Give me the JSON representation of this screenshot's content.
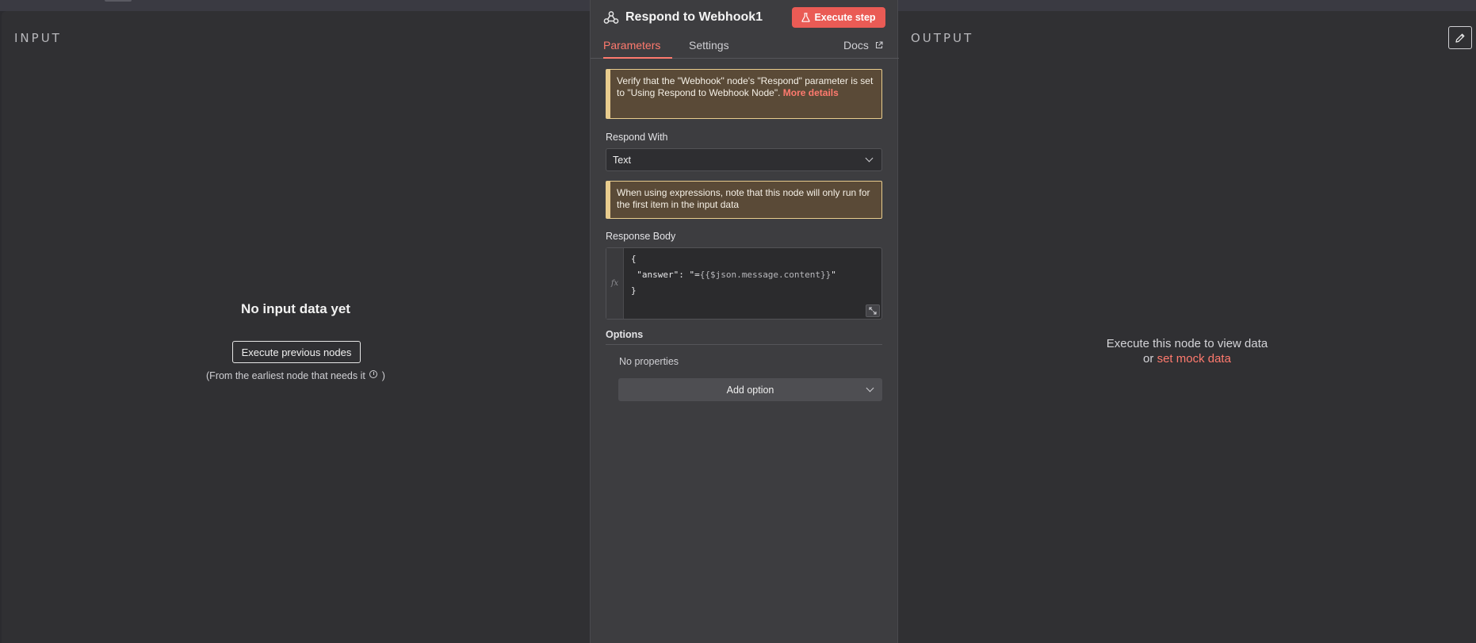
{
  "input_panel": {
    "label": "INPUT",
    "empty_title": "No input data yet",
    "execute_previous_label": "Execute previous nodes",
    "note_prefix": "(From the earliest node that needs it",
    "note_suffix": ")"
  },
  "node_panel": {
    "title": "Respond to Webhook1",
    "execute_step_label": "Execute step",
    "tabs": [
      {
        "label": "Parameters",
        "active": true
      },
      {
        "label": "Settings",
        "active": false
      }
    ],
    "docs_label": "Docs",
    "notice_webhook": {
      "text": "Verify that the \"Webhook\" node's \"Respond\" parameter is set to \"Using Respond to Webhook Node\". ",
      "link": "More details"
    },
    "respond_with": {
      "label": "Respond With",
      "value": "Text"
    },
    "notice_expressions": {
      "text": "When using expressions, note that this node will only run for the first item in the input data"
    },
    "response_body": {
      "label": "Response Body",
      "gutter": "fx",
      "line1": "{",
      "line2_prefix": "  \"answer\": \"=",
      "line2_expr": "{{$json.message.content}}",
      "line2_suffix": "\"",
      "line3": "}"
    },
    "options": {
      "label": "Options",
      "empty": "No properties",
      "add_label": "Add option"
    }
  },
  "output_panel": {
    "label": "OUTPUT",
    "message_line1": "Execute this node to view data",
    "message_or": "or ",
    "mock_link": "set mock data"
  },
  "colors": {
    "accent": "#ea5b55",
    "link": "#ff7a6e",
    "warning_border": "#e8cc8e",
    "warning_bg": "#5a4a37"
  }
}
